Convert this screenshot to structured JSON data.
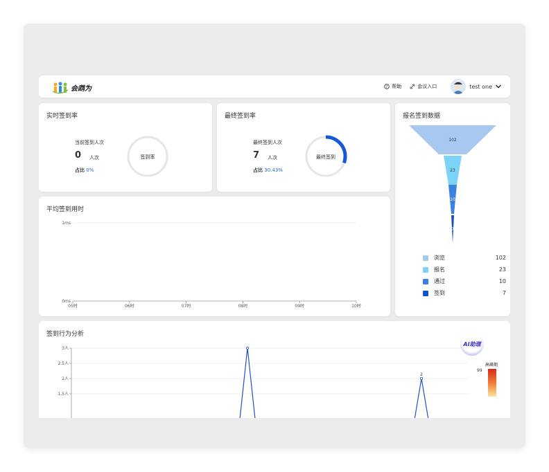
{
  "header": {
    "logo_text": "会鹉为",
    "help": "帮助",
    "meeting_entry": "会议入口",
    "username": "test  one"
  },
  "realtime": {
    "title": "实时签到率",
    "label": "当前签到人次",
    "count": "0",
    "unit": "人次",
    "ratio_label": "占比",
    "ratio_value": "0%",
    "ring_label": "签到率",
    "progress": 0
  },
  "final": {
    "title": "最终签到率",
    "label": "最终签到人次",
    "count": "7",
    "unit": "人次",
    "ratio_label": "占比",
    "ratio_value": "30.43%",
    "ring_label": "最终签到",
    "progress": 0.3043
  },
  "funnel": {
    "title": "报名签到数据",
    "stages": [
      {
        "name": "浏览",
        "value": 102,
        "color": "#a8c8f0"
      },
      {
        "name": "报名",
        "value": 23,
        "color": "#7dd3f7"
      },
      {
        "name": "通过",
        "value": 10,
        "color": "#3b82e0"
      },
      {
        "name": "签到",
        "value": 7,
        "color": "#1450c8"
      }
    ],
    "value_labels": [
      "102",
      "23",
      "10",
      "7"
    ],
    "legend_values": [
      "102",
      "23",
      "10",
      "7"
    ]
  },
  "avgtime": {
    "title": "平均签到用时",
    "chart_data": {
      "type": "line",
      "categories": [
        "05时",
        "06时",
        "07时",
        "08时",
        "09时",
        "10时"
      ],
      "y_ticks": [
        "1ms",
        "0ms"
      ],
      "ylim": [
        0,
        1
      ]
    }
  },
  "behavior": {
    "title": "签到行为分析",
    "ai_badge": "AI助理",
    "peak_label": "高峰期",
    "peak_value": "99",
    "chart_data": {
      "type": "line",
      "y_ticks": [
        "3人",
        "2.5人",
        "2人",
        "1.5人"
      ],
      "points_labels": [
        "2"
      ],
      "peaks": [
        3,
        2
      ]
    }
  }
}
